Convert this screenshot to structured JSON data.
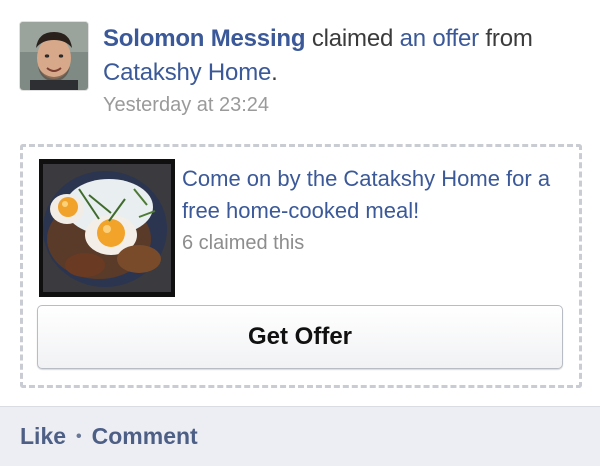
{
  "story": {
    "actor_name": "Solomon Messing",
    "verb_text": " claimed ",
    "object_link": "an offer",
    "from_text": " from ",
    "page_link": "Catakshy Home",
    "end_punct": ".",
    "timestamp": "Yesterday at 23:24"
  },
  "offer": {
    "title": "Come on by the Catakshy Home for a free home-cooked meal!",
    "claimed_count": "6 claimed this",
    "button_label": "Get Offer"
  },
  "footer": {
    "like_label": "Like",
    "separator": "•",
    "comment_label": "Comment"
  },
  "colors": {
    "link": "#3b5998",
    "footer_bg": "#eceef4",
    "muted": "#9a9a9a"
  }
}
